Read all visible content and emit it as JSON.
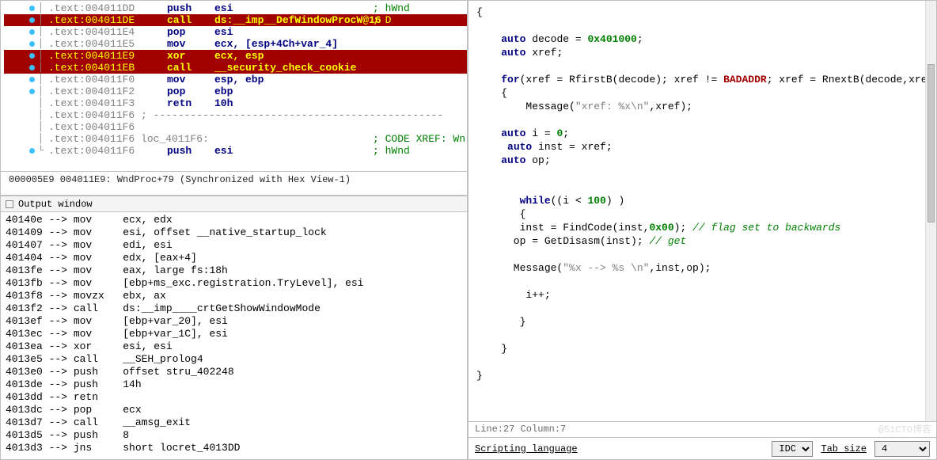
{
  "disasm": {
    "lines": [
      {
        "bullet": true,
        "addr": ".text:004011DD",
        "mnem": "push",
        "op": "esi",
        "cmt": "; hWnd"
      },
      {
        "bullet": true,
        "hl": true,
        "addr": ".text:004011DE",
        "mnem": "call",
        "op": "ds:__imp__DefWindowProcW@16",
        "cmt": "; D"
      },
      {
        "bullet": true,
        "addr": ".text:004011E4",
        "mnem": "pop",
        "op": "esi"
      },
      {
        "bullet": true,
        "addr": ".text:004011E5",
        "mnem": "mov",
        "op": "ecx, [esp+4Ch+var_4]"
      },
      {
        "bullet": true,
        "hl": true,
        "addr": ".text:004011E9",
        "mnem": "xor",
        "op": "ecx, esp"
      },
      {
        "bullet": true,
        "hl": true,
        "addr": ".text:004011EB",
        "mnem": "call",
        "op": "__security_check_cookie"
      },
      {
        "bullet": true,
        "addr": ".text:004011F0",
        "mnem": "mov",
        "op": "esp, ebp"
      },
      {
        "bullet": true,
        "addr": ".text:004011F2",
        "mnem": "pop",
        "op": "ebp"
      },
      {
        "addr": ".text:004011F3",
        "mnem": "retn",
        "op": "10h"
      },
      {
        "addr": ".text:004011F6 ; -----------------------------------------------",
        "mnem": "",
        "op": ""
      },
      {
        "addr": ".text:004011F6",
        "mnem": "",
        "op": ""
      },
      {
        "addr": ".text:004011F6 loc_4011F6:",
        "mnem": "",
        "op": "",
        "cmt": "; CODE XREF: Wn"
      },
      {
        "bullet": true,
        "last": true,
        "addr": ".text:004011F6",
        "mnem": "push",
        "op": "esi",
        "cmt": "; hWnd"
      }
    ],
    "status": "000005E9 004011E9: WndProc+79 (Synchronized with Hex View-1)"
  },
  "output": {
    "title": "Output window",
    "lines": [
      "40140e --> mov     ecx, edx",
      "401409 --> mov     esi, offset __native_startup_lock",
      "401407 --> mov     edi, esi",
      "401404 --> mov     edx, [eax+4]",
      "4013fe --> mov     eax, large fs:18h",
      "4013fb --> mov     [ebp+ms_exc.registration.TryLevel], esi",
      "4013f8 --> movzx   ebx, ax",
      "4013f2 --> call    ds:__imp____crtGetShowWindowMode",
      "4013ef --> mov     [ebp+var_20], esi",
      "4013ec --> mov     [ebp+var_1C], esi",
      "4013ea --> xor     esi, esi",
      "4013e5 --> call    __SEH_prolog4",
      "4013e0 --> push    offset stru_402248",
      "4013de --> push    14h",
      "4013dd --> retn",
      "4013dc --> pop     ecx",
      "4013d7 --> call    __amsg_exit",
      "4013d5 --> push    8",
      "4013d3 --> jns     short locret_4013DD"
    ]
  },
  "script": {
    "tokens": [
      [
        [
          "",
          "{"
        ]
      ],
      [],
      [
        [
          "",
          "    "
        ],
        [
          "kw",
          "auto"
        ],
        [
          "",
          " decode = "
        ],
        [
          "num",
          "0x401000"
        ],
        [
          "",
          ";"
        ]
      ],
      [
        [
          "",
          "    "
        ],
        [
          "kw",
          "auto"
        ],
        [
          "",
          " xref;"
        ]
      ],
      [],
      [
        [
          "",
          "    "
        ],
        [
          "kw",
          "for"
        ],
        [
          "",
          "(xref = RfirstB(decode); xref != "
        ],
        [
          "bad",
          "BADADDR"
        ],
        [
          "",
          "; xref = RnextB(decode,xref))"
        ]
      ],
      [
        [
          "",
          "    {"
        ]
      ],
      [
        [
          "",
          "        Message("
        ],
        [
          "str",
          "\"xref: %x\\n\""
        ],
        [
          "",
          ",xref);"
        ]
      ],
      [],
      [
        [
          "",
          "    "
        ],
        [
          "kw",
          "auto"
        ],
        [
          "",
          " i = "
        ],
        [
          "num",
          "0"
        ],
        [
          "",
          ";"
        ]
      ],
      [
        [
          "",
          "     "
        ],
        [
          "kw",
          "auto"
        ],
        [
          "",
          " inst = xref;"
        ]
      ],
      [
        [
          "",
          "    "
        ],
        [
          "kw",
          "auto"
        ],
        [
          "",
          " op;"
        ]
      ],
      [],
      [],
      [
        [
          "",
          "       "
        ],
        [
          "kw",
          "while"
        ],
        [
          "",
          "((i < "
        ],
        [
          "num",
          "100"
        ],
        [
          "",
          ") )"
        ]
      ],
      [
        [
          "",
          "       {"
        ]
      ],
      [
        [
          "",
          "       inst = FindCode(inst,"
        ],
        [
          "num",
          "0x00"
        ],
        [
          "",
          "); "
        ],
        [
          "com",
          "// flag set to backwards"
        ]
      ],
      [
        [
          "",
          "      op = GetDisasm(inst); "
        ],
        [
          "com",
          "// get"
        ]
      ],
      [],
      [
        [
          "",
          "      Message("
        ],
        [
          "str",
          "\"%x --> %s \\n\""
        ],
        [
          "",
          ",inst,op);"
        ]
      ],
      [],
      [
        [
          "",
          "        i++;"
        ]
      ],
      [],
      [
        [
          "",
          "       }"
        ]
      ],
      [],
      [
        [
          "",
          "    }"
        ]
      ],
      [],
      [
        [
          "",
          "}"
        ]
      ]
    ],
    "status": "Line:27 Column:7",
    "lang_label": "Scripting language",
    "lang_value": "IDC",
    "tab_label": "Tab size",
    "tab_value": "4"
  },
  "chart_data": null,
  "watermark": "@51CTO博客"
}
